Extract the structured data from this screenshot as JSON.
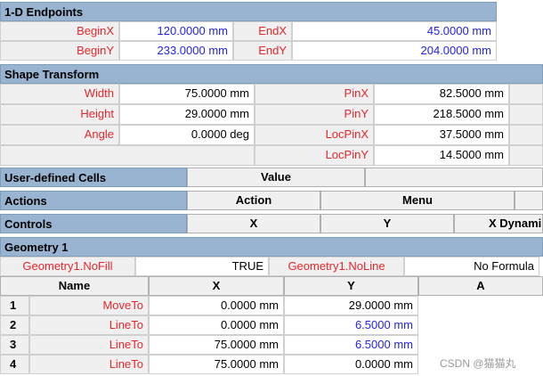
{
  "endpoints": {
    "title": "1-D Endpoints",
    "begin_x_label": "BeginX",
    "begin_x_value": "120.0000 mm",
    "end_x_label": "EndX",
    "end_x_value": "45.0000 mm",
    "begin_y_label": "BeginY",
    "begin_y_value": "233.0000 mm",
    "end_y_label": "EndY",
    "end_y_value": "204.0000 mm"
  },
  "shape_transform": {
    "title": "Shape Transform",
    "rows": [
      {
        "left_label": "Width",
        "left_value": "75.0000 mm",
        "right_label": "PinX",
        "right_value": "82.5000 mm"
      },
      {
        "left_label": "Height",
        "left_value": "29.0000 mm",
        "right_label": "PinY",
        "right_value": "218.5000 mm"
      },
      {
        "left_label": "Angle",
        "left_value": "0.0000 deg",
        "right_label": "LocPinX",
        "right_value": "37.5000 mm"
      },
      {
        "left_label": "",
        "left_value": "",
        "right_label": "LocPinY",
        "right_value": "14.5000 mm"
      }
    ]
  },
  "user_defined": {
    "title": "User-defined Cells",
    "col_value": "Value"
  },
  "actions": {
    "title": "Actions",
    "col_action": "Action",
    "col_menu": "Menu"
  },
  "controls": {
    "title": "Controls",
    "col_x": "X",
    "col_y": "Y",
    "col_xdyn": "X Dynami"
  },
  "geometry": {
    "title": "Geometry 1",
    "nofill_label": "Geometry1.NoFill",
    "nofill_value": "TRUE",
    "noline_label": "Geometry1.NoLine",
    "noline_value": "No Formula",
    "col_name": "Name",
    "col_x": "X",
    "col_y": "Y",
    "col_a": "A",
    "rows": [
      {
        "num": "1",
        "name": "MoveTo",
        "x": "0.0000 mm",
        "y": "29.0000 mm"
      },
      {
        "num": "2",
        "name": "LineTo",
        "x": "0.0000 mm",
        "y": "6.5000 mm"
      },
      {
        "num": "3",
        "name": "LineTo",
        "x": "75.0000 mm",
        "y": "6.5000 mm"
      },
      {
        "num": "4",
        "name": "LineTo",
        "x": "75.0000 mm",
        "y": "0.0000 mm"
      }
    ]
  },
  "watermark": "CSDN @猫猫丸",
  "colors": {
    "section": "#99b4d1",
    "label_red": "#e8262b",
    "value_blue": "#2424e8",
    "gray": "#f0f0f0"
  }
}
